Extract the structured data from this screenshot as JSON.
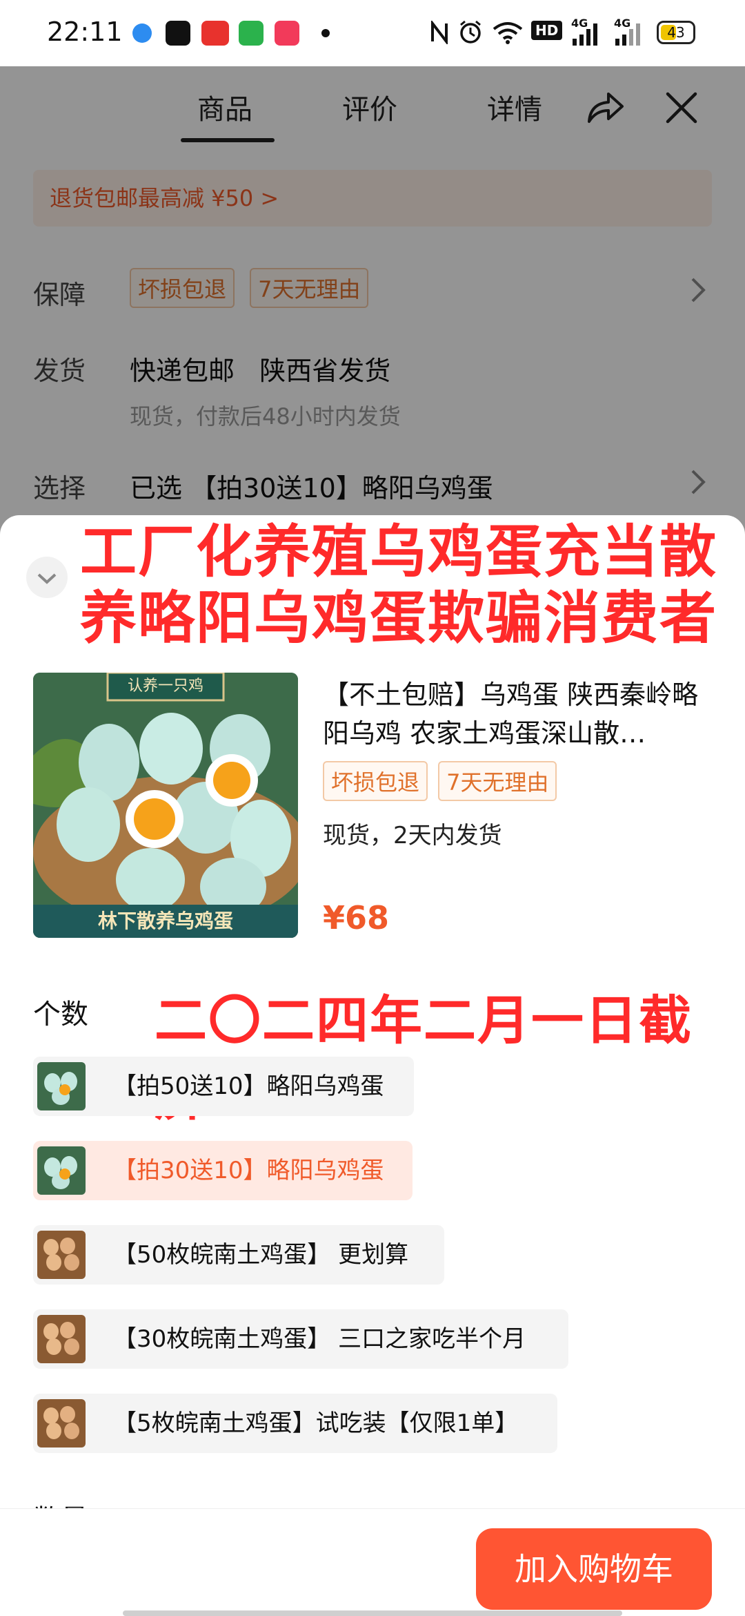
{
  "status_bar": {
    "time": "22:11",
    "battery": "43",
    "net_4g_1": "4G",
    "net_4g_2": "4G",
    "hd_label": "HD"
  },
  "tabs": [
    {
      "label": "商品"
    },
    {
      "label": "评价"
    },
    {
      "label": "详情"
    }
  ],
  "promo_text": "退货包邮最高减 ¥50 >",
  "guarantee": {
    "label": "保障",
    "tags": [
      "坏损包退",
      "7天无理由"
    ]
  },
  "shipping": {
    "label": "发货",
    "value": "快递包邮   陕西省发货",
    "note": "现货，付款后48小时内发货"
  },
  "select": {
    "label": "选择",
    "value": "已选 【拍30送10】略阳乌鸡蛋"
  },
  "sheet": {
    "banner_line1": "工厂化养殖乌鸡蛋充当散",
    "banner_line2": "养略阳乌鸡蛋欺骗消费者",
    "image_top_caption": "认养一只鸡",
    "image_bottom_caption": "林下散养乌鸡蛋",
    "product_title": "【不土包赔】乌鸡蛋 陕西秦岭略阳乌鸡 农家土鸡蛋深山散…",
    "product_tags": [
      "坏损包退",
      "7天无理由"
    ],
    "shipping": "现货，2天内发货",
    "price": "¥68",
    "count_label": "个数",
    "date_banner": "二〇二四年二月一日截屏",
    "options": [
      {
        "label": "【拍50送10】略阳乌鸡蛋",
        "selected": false,
        "kind": "blue-eggs"
      },
      {
        "label": "【拍30送10】略阳乌鸡蛋",
        "selected": true,
        "kind": "blue-eggs"
      },
      {
        "label": "【50枚皖南土鸡蛋】 更划算",
        "selected": false,
        "kind": "brown-eggs"
      },
      {
        "label": "【30枚皖南土鸡蛋】 三口之家吃半个月",
        "selected": false,
        "kind": "brown-eggs"
      },
      {
        "label": "【5枚皖南土鸡蛋】试吃装【仅限1单】",
        "selected": false,
        "kind": "brown-eggs"
      }
    ],
    "qty_label": "数量",
    "cart_button": "加入购物车"
  },
  "colors": {
    "accent": "#f05a2a",
    "banner_red": "#ff2a2a",
    "cart_button": "#ff5533"
  }
}
